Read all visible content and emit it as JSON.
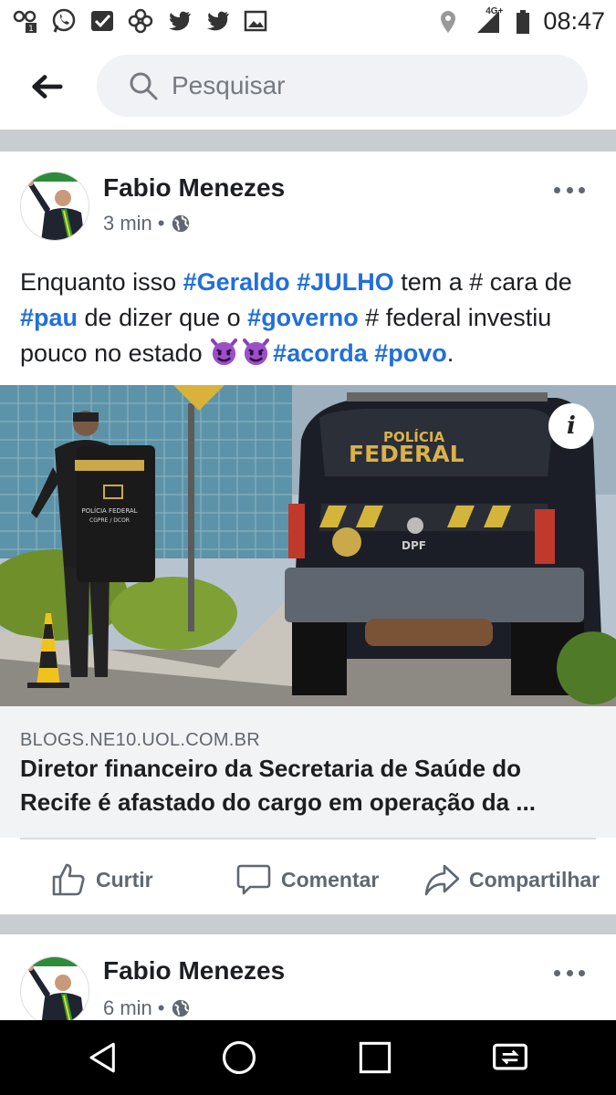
{
  "status_bar": {
    "time": "08:47",
    "network": "4G+",
    "left_icons": [
      "glasses-notification-icon",
      "whatsapp-icon",
      "checkbox-icon",
      "clover-icon",
      "twitter-icon",
      "twitter-icon",
      "gallery-icon"
    ],
    "right_icons": [
      "location-icon",
      "signal-icon",
      "battery-icon"
    ]
  },
  "search": {
    "placeholder": "Pesquisar"
  },
  "posts": [
    {
      "author": "Fabio Menezes",
      "time": "3 min",
      "text_parts": [
        {
          "t": "Enquanto isso ",
          "tag": false
        },
        {
          "t": "#Geraldo",
          "tag": true
        },
        {
          "t": " ",
          "tag": false
        },
        {
          "t": "#JULHO",
          "tag": true
        },
        {
          "t": " tem a # cara de ",
          "tag": false
        },
        {
          "t": "#pau",
          "tag": true
        },
        {
          "t": " de dizer que o ",
          "tag": false
        },
        {
          "t": "#governo",
          "tag": true
        },
        {
          "t": " # federal investiu pouco no estado ",
          "tag": false
        },
        {
          "t": "#acorda",
          "tag": true
        },
        {
          "t": " ",
          "tag": false
        },
        {
          "t": "#povo",
          "tag": true
        },
        {
          "t": ".",
          "tag": false
        }
      ],
      "link": {
        "domain": "BLOGS.NE10.UOL.COM.BR",
        "title": "Diretor financeiro da Secretaria de Saúde do Recife é afastado do cargo em operação da ...",
        "image_text": {
          "vehicle_top": "POLÍCIA",
          "vehicle_main": "FEDERAL",
          "plate_label": "DPF",
          "vest_text": "POLÍCIA FEDERAL",
          "vest_sub": "CGPRE / DCOR"
        }
      },
      "actions": {
        "like": "Curtir",
        "comment": "Comentar",
        "share": "Compartilhar"
      }
    },
    {
      "author": "Fabio Menezes",
      "time": "6 min"
    }
  ],
  "colors": {
    "hashtag": "#216fdb",
    "divider": "#c9ccd1",
    "link_box": "#f2f3f5",
    "secondary_text": "#606770"
  }
}
